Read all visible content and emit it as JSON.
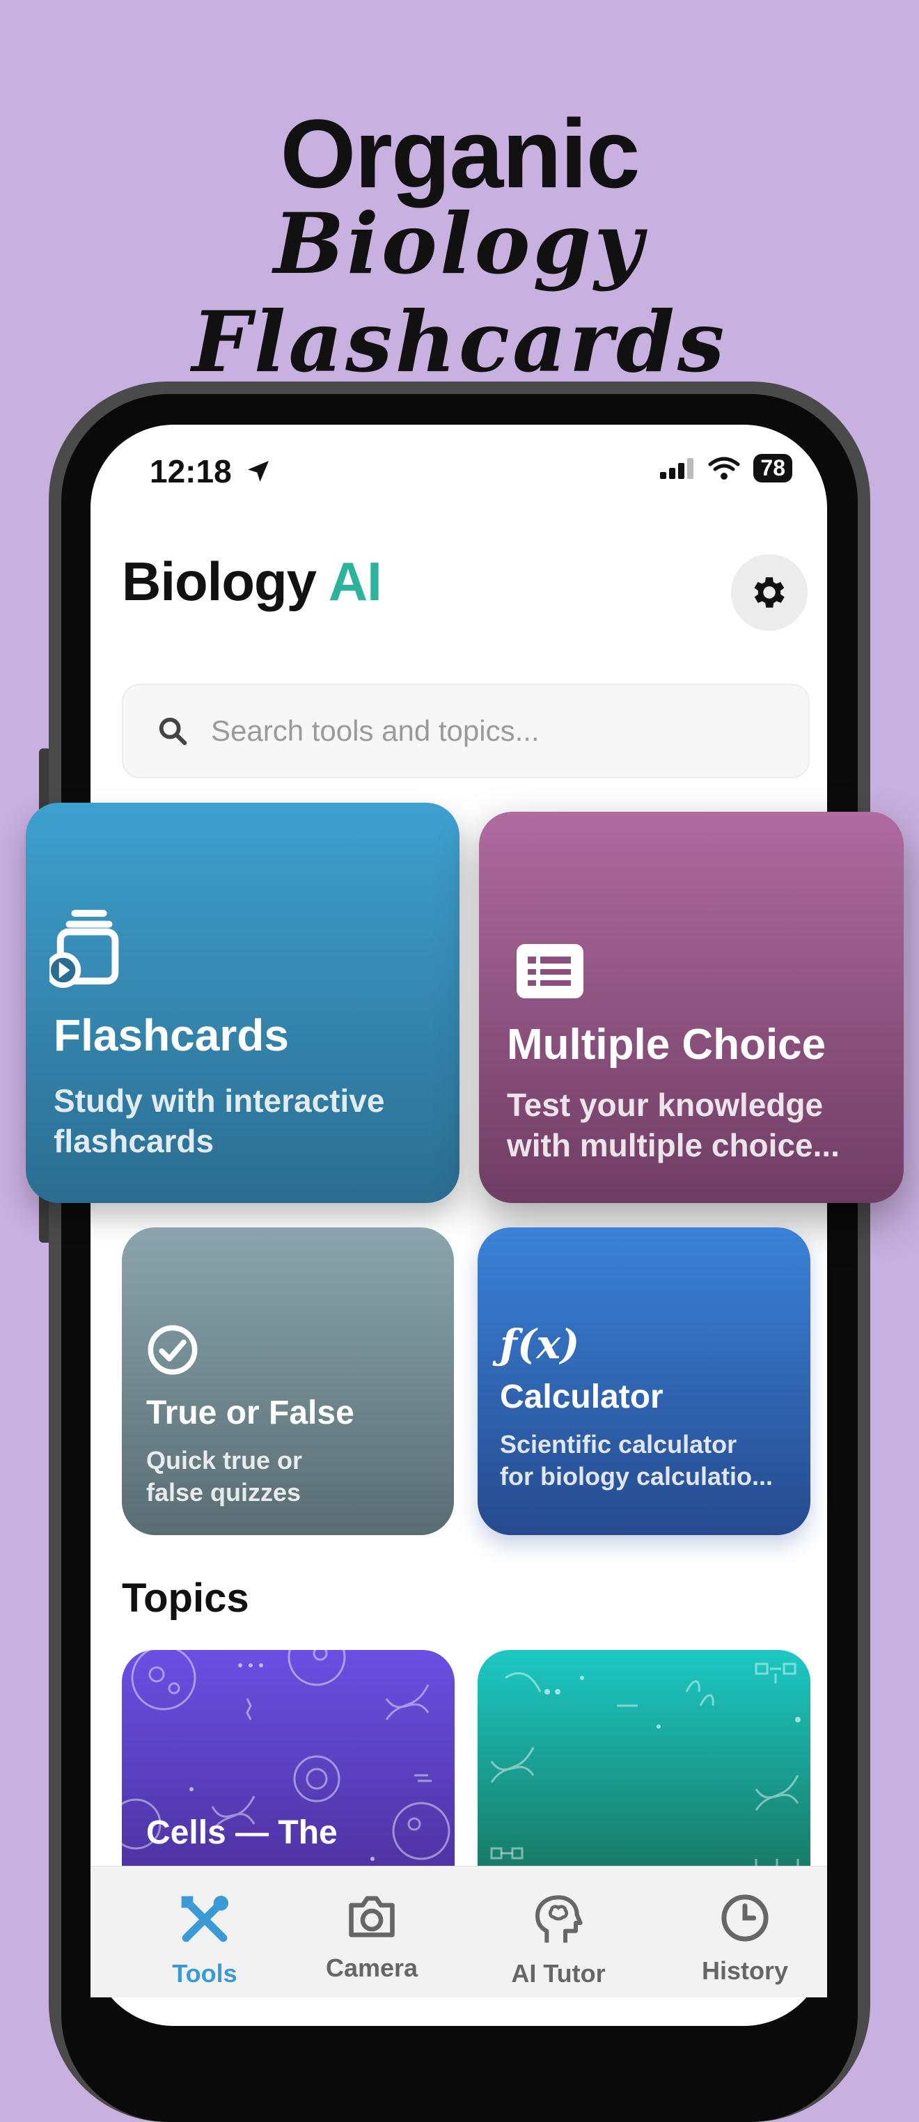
{
  "promo": {
    "line1": "Organic",
    "line2": "Biology Flashcards"
  },
  "status_bar": {
    "time": "12:18",
    "battery": "78"
  },
  "header": {
    "title_main": "Biology",
    "title_accent": "AI",
    "accent_color": "#2db39b"
  },
  "search": {
    "placeholder": "Search tools and topics..."
  },
  "tools": [
    {
      "title": "Flashcards",
      "desc_line1": "Study with interactive",
      "desc_line2": "flashcards",
      "icon": "flashcards-icon",
      "color": "#3ea0cf"
    },
    {
      "title": "Multiple Choice",
      "desc_line1": "Test your knowledge",
      "desc_line2": "with multiple choice...",
      "icon": "list-icon",
      "color": "#b06a9f"
    },
    {
      "title": "True or False",
      "desc_line1": "Quick true or",
      "desc_line2": "false quizzes",
      "icon": "check-circle-icon",
      "color": "#8aa5ad"
    },
    {
      "title": "Calculator",
      "desc_line1": "Scientific calculator",
      "desc_line2": "for biology calculatio...",
      "icon": "function-icon",
      "icon_text": "ƒ(x)",
      "color": "#3a82d8"
    }
  ],
  "topics": {
    "heading": "Topics",
    "items": [
      {
        "label": "Cells — The",
        "color": "#6a4fe3"
      },
      {
        "label": "",
        "color": "#1cc8c4"
      }
    ]
  },
  "tabbar": {
    "items": [
      {
        "label": "Tools",
        "icon": "tools-icon",
        "active": true
      },
      {
        "label": "Camera",
        "icon": "camera-icon",
        "active": false
      },
      {
        "label": "AI Tutor",
        "icon": "brain-icon",
        "active": false
      },
      {
        "label": "History",
        "icon": "clock-icon",
        "active": false
      }
    ],
    "active_color": "#3a9ad6"
  }
}
